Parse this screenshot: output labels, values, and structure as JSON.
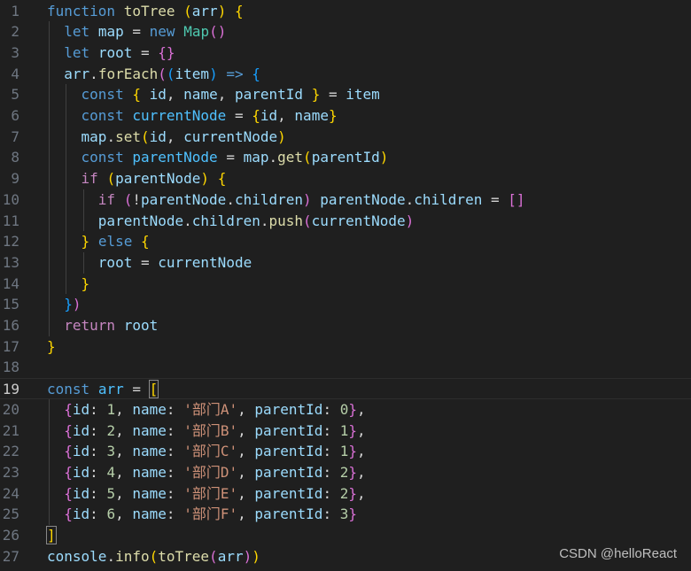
{
  "editor": {
    "language": "javascript",
    "current_line": 19,
    "lines": [
      {
        "n": 1,
        "text": "function toTree (arr) {"
      },
      {
        "n": 2,
        "text": "  let map = new Map()"
      },
      {
        "n": 3,
        "text": "  let root = {}"
      },
      {
        "n": 4,
        "text": "  arr.forEach((item) => {"
      },
      {
        "n": 5,
        "text": "    const { id, name, parentId } = item"
      },
      {
        "n": 6,
        "text": "    const currentNode = {id, name}"
      },
      {
        "n": 7,
        "text": "    map.set(id, currentNode)"
      },
      {
        "n": 8,
        "text": "    const parentNode = map.get(parentId)"
      },
      {
        "n": 9,
        "text": "    if (parentNode) {"
      },
      {
        "n": 10,
        "text": "      if (!parentNode.children) parentNode.children = []"
      },
      {
        "n": 11,
        "text": "      parentNode.children.push(currentNode)"
      },
      {
        "n": 12,
        "text": "    } else {"
      },
      {
        "n": 13,
        "text": "      root = currentNode"
      },
      {
        "n": 14,
        "text": "    }"
      },
      {
        "n": 15,
        "text": "  })"
      },
      {
        "n": 16,
        "text": "  return root"
      },
      {
        "n": 17,
        "text": "}"
      },
      {
        "n": 18,
        "text": ""
      },
      {
        "n": 19,
        "text": "const arr = ["
      },
      {
        "n": 20,
        "text": "  {id: 1, name: '部门A', parentId: 0},"
      },
      {
        "n": 21,
        "text": "  {id: 2, name: '部门B', parentId: 1},"
      },
      {
        "n": 22,
        "text": "  {id: 3, name: '部门C', parentId: 1},"
      },
      {
        "n": 23,
        "text": "  {id: 4, name: '部门D', parentId: 2},"
      },
      {
        "n": 24,
        "text": "  {id: 5, name: '部门E', parentId: 2},"
      },
      {
        "n": 25,
        "text": "  {id: 6, name: '部门F', parentId: 3}"
      },
      {
        "n": 26,
        "text": "]"
      },
      {
        "n": 27,
        "text": "console.info(toTree(arr))"
      }
    ]
  },
  "watermark": "CSDN @helloReact",
  "colors": {
    "background": "#1f1f1f",
    "line_number": "#6e7681",
    "keyword": "#569cd6",
    "control": "#c586c0",
    "function": "#dcdcaa",
    "variable": "#9cdcfe",
    "constant": "#4fc1ff",
    "class": "#4ec9b0",
    "string": "#ce9178",
    "number": "#b5cea8",
    "bracket_1": "#ffd700",
    "bracket_2": "#da70d6",
    "bracket_3": "#179fff"
  }
}
